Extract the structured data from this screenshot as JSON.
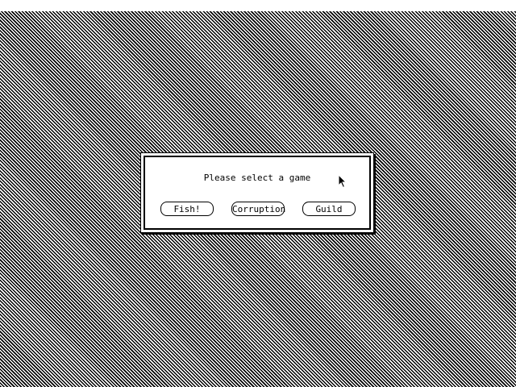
{
  "dialog": {
    "prompt": "Please select a game",
    "buttons": [
      "Fish!",
      "Corruption",
      "Guild"
    ]
  },
  "colors": {
    "foreground": "#000000",
    "background": "#ffffff"
  },
  "cursor": {
    "icon": "arrow-cursor-icon"
  }
}
